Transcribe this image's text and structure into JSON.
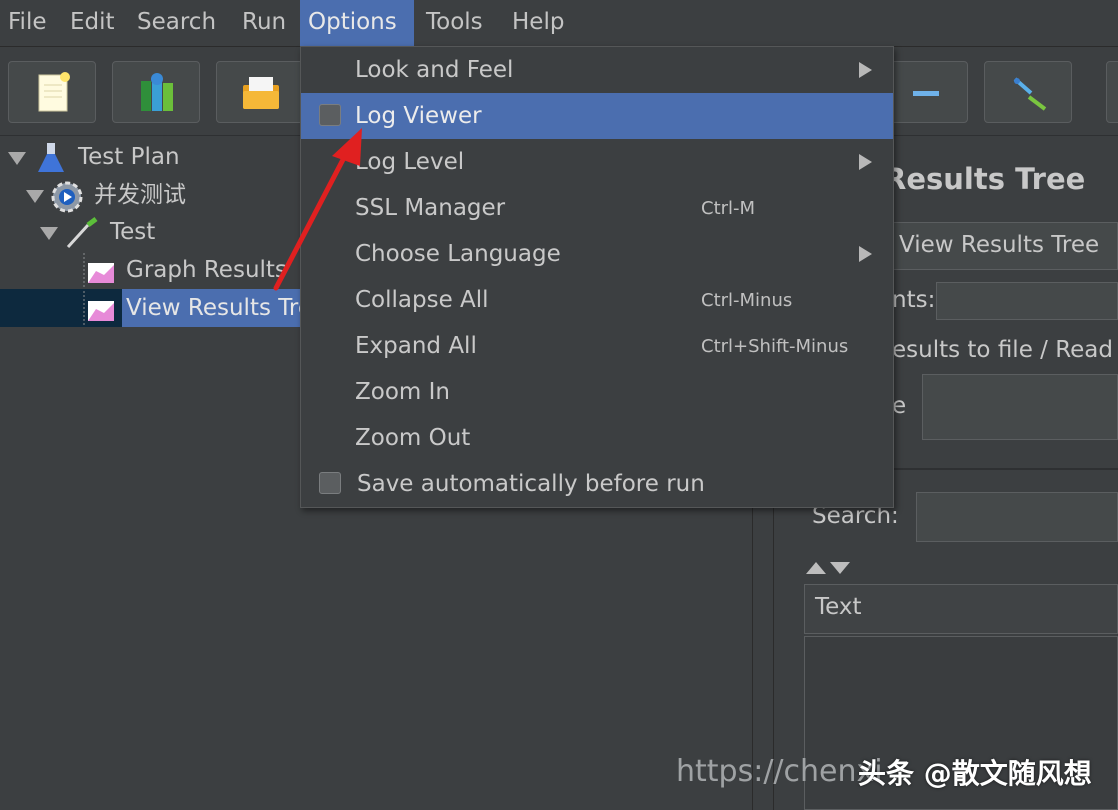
{
  "menubar": {
    "items": [
      "File",
      "Edit",
      "Search",
      "Run",
      "Options",
      "Tools",
      "Help"
    ],
    "active": "Options"
  },
  "tree": {
    "items": [
      {
        "label": "Test Plan",
        "icon": "flask-icon"
      },
      {
        "label": "并发测试",
        "icon": "thread-group-gear-icon"
      },
      {
        "label": "Test",
        "icon": "sampler-pipette-icon"
      },
      {
        "label": "Graph Results",
        "icon": "listener-graph-icon"
      },
      {
        "label": "View Results Tre",
        "icon": "listener-graph-icon",
        "selected": true
      }
    ]
  },
  "right_panel": {
    "title": "Results Tree",
    "name_value": "View Results Tree",
    "comments_label": "nts:",
    "write_results_label": "esults to file / Read f",
    "filename_label": "e",
    "search_label": "Search:",
    "text_header": "Text"
  },
  "options_menu": {
    "items": [
      {
        "label": "Look and Feel",
        "shortcut": "",
        "submenu": true,
        "checkbox": false
      },
      {
        "label": "Log Viewer",
        "shortcut": "",
        "submenu": false,
        "checkbox": true,
        "highlighted": true
      },
      {
        "label": "Log Level",
        "shortcut": "",
        "submenu": true,
        "checkbox": false
      },
      {
        "label": "SSL Manager",
        "shortcut": "Ctrl-M",
        "submenu": false,
        "checkbox": false
      },
      {
        "label": "Choose Language",
        "shortcut": "",
        "submenu": true,
        "checkbox": false
      },
      {
        "label": "Collapse All",
        "shortcut": "Ctrl-Minus",
        "submenu": false,
        "checkbox": false
      },
      {
        "label": "Expand All",
        "shortcut": "Ctrl+Shift-Minus",
        "submenu": false,
        "checkbox": false
      },
      {
        "label": "Zoom In",
        "shortcut": "",
        "submenu": false,
        "checkbox": false
      },
      {
        "label": "Zoom Out",
        "shortcut": "",
        "submenu": false,
        "checkbox": false
      },
      {
        "label": "Save automatically before run",
        "shortcut": "",
        "submenu": false,
        "checkbox": true
      }
    ]
  },
  "watermark": {
    "url": "https://chenxi",
    "brand": "头条 @散文随风想"
  },
  "colors": {
    "background": "#3c3f41",
    "selection": "#4b6eaf",
    "annotation_arrow": "#e02020"
  }
}
